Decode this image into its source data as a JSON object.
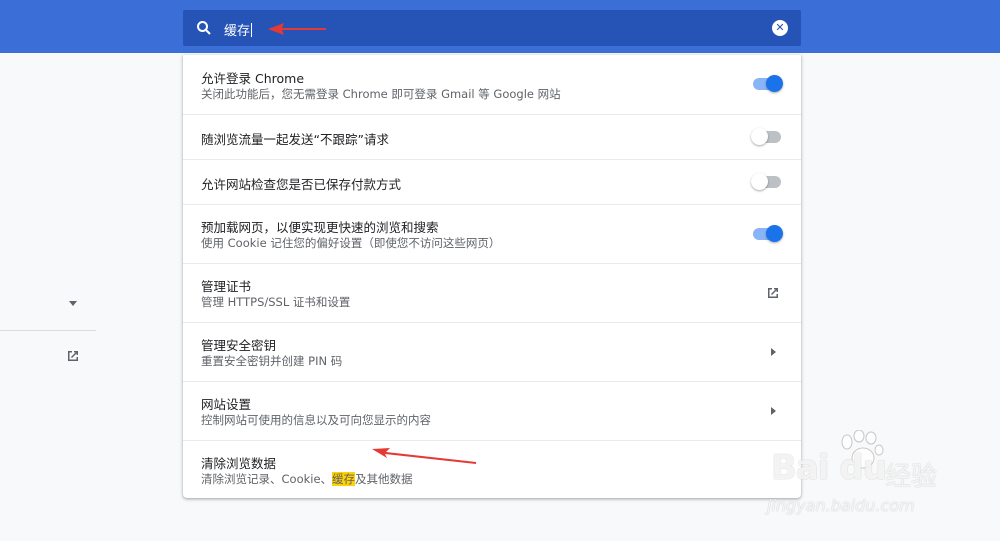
{
  "search": {
    "value": "缓存",
    "clear_icon": "close-circle-icon"
  },
  "rows": [
    {
      "title": "允许登录 Chrome",
      "subtitle": "关闭此功能后，您无需登录 Chrome 即可登录 Gmail 等 Google 网站",
      "control": "toggle",
      "state": "on"
    },
    {
      "title": "随浏览流量一起发送“不跟踪”请求",
      "control": "toggle",
      "state": "off"
    },
    {
      "title": "允许网站检查您是否已保存付款方式",
      "control": "toggle",
      "state": "off"
    },
    {
      "title": "预加载网页，以便实现更快速的浏览和搜索",
      "subtitle": "使用 Cookie 记住您的偏好设置（即使您不访问这些网页）",
      "control": "toggle",
      "state": "on"
    },
    {
      "title": "管理证书",
      "subtitle": "管理 HTTPS/SSL 证书和设置",
      "control": "external-link-icon"
    },
    {
      "title": "管理安全密钥",
      "subtitle": "重置安全密钥并创建 PIN 码",
      "control": "chevron-right-icon"
    },
    {
      "title": "网站设置",
      "subtitle": "控制网站可使用的信息以及可向您显示的内容",
      "control": "chevron-right-icon"
    },
    {
      "title": "清除浏览数据",
      "subtitle_before": "清除浏览记录、Cookie、",
      "subtitle_highlight": "缓存",
      "subtitle_after": "及其他数据"
    }
  ],
  "watermark": {
    "logo": "Bai du",
    "brand": "经验",
    "url": "jingyan.baidu.com"
  },
  "colors": {
    "topbar": "#3b6ed6",
    "search_bg": "#2553b6",
    "toggle_on": "#1a73e8",
    "annotation_arrow": "#e53935",
    "highlight": "#ffd200"
  }
}
